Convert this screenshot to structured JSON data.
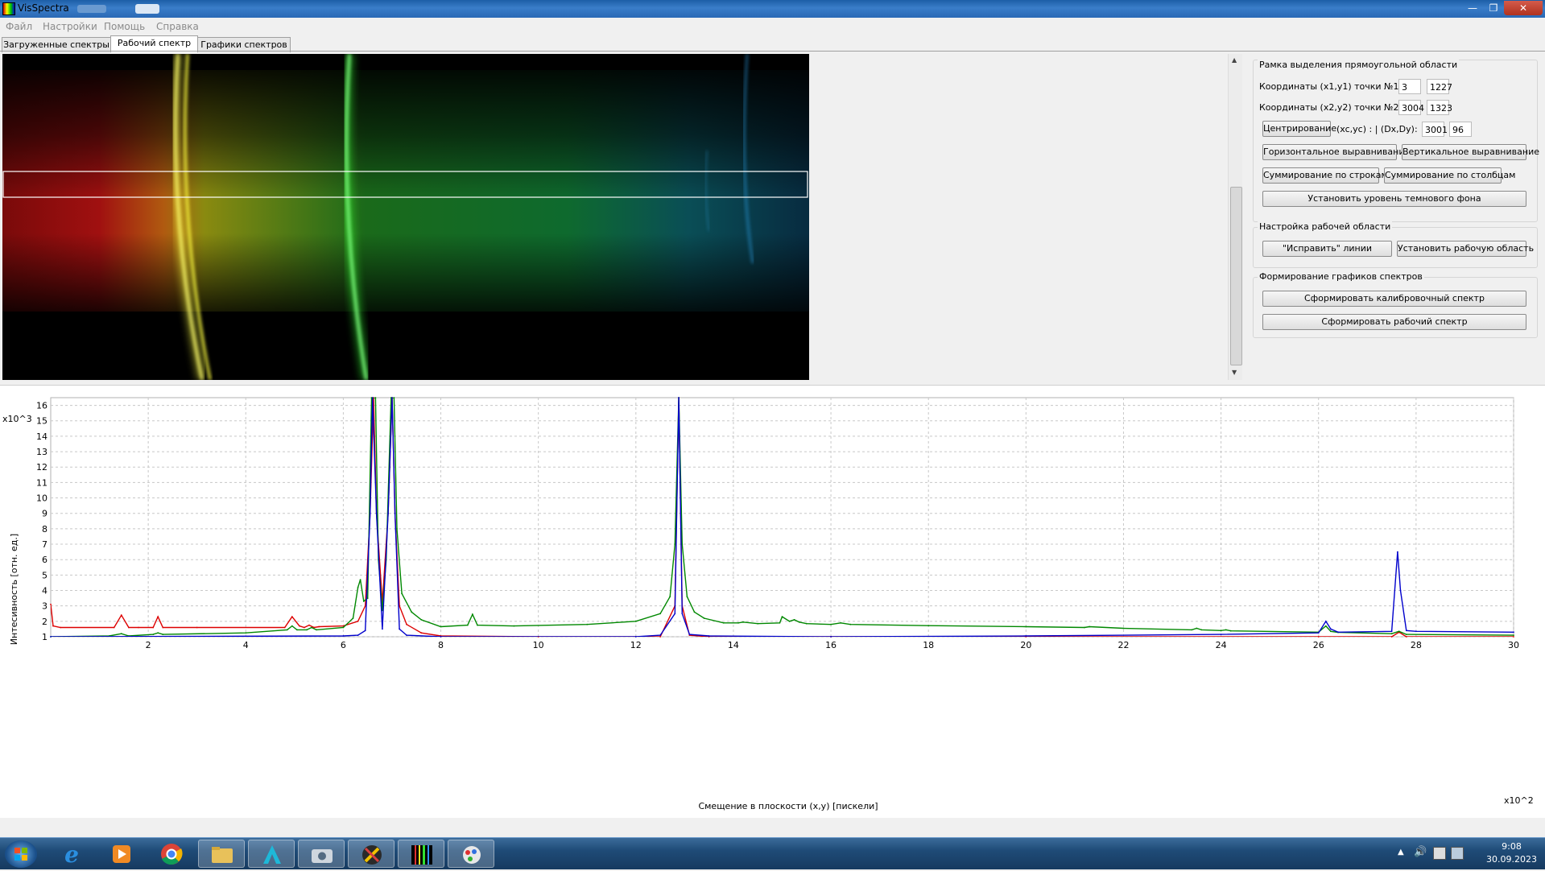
{
  "window": {
    "title": "VisSpectra"
  },
  "menu": [
    "Файл",
    "Настройки",
    "Помощь",
    "Справка"
  ],
  "tabs": [
    {
      "label": "Загруженные спектры",
      "active": false
    },
    {
      "label": "Рабочий спектр",
      "active": true
    },
    {
      "label": "Графики спектров",
      "active": false
    }
  ],
  "panel": {
    "group1": {
      "title": "Рамка выделения прямоугольной области",
      "p1_label": "Координаты (x1,y1) точки №1 :",
      "p1_x": "3",
      "p1_y": "1227",
      "p2_label": "Координаты (x2,y2) точки №2 :",
      "p2_x": "3004",
      "p2_y": "1323",
      "center_button": "Центрирование",
      "center_label": "(xc,yc) :   |  (Dx,Dy):",
      "dx": "3001",
      "dy": "96",
      "h_align": "Горизонтальное выравнивание",
      "v_align": "Вертикальное выравнивание",
      "sum_rows": "Суммирование  по  строкам",
      "sum_cols": "Суммирование по столбцам",
      "dark_level": "Установить уровень темнового фона"
    },
    "group2": {
      "title": "Настройка рабочей области",
      "fix_lines": "\"Исправить\" линии",
      "set_area": "Установить рабочую область"
    },
    "group3": {
      "title": "Формирование графиков спектров",
      "calib": "Сформировать калибровочный спектр",
      "work": "Сформировать рабочий спектр"
    }
  },
  "chart_data": {
    "type": "line",
    "xlabel": "Смещение в плоскости (x,y) [пискели]",
    "ylabel": "Интесивность [отн. ед.]",
    "x_multiplier": "x10^2",
    "y_multiplier": "x10^3",
    "xlim": [
      0,
      30
    ],
    "ylim": [
      1,
      16.5
    ],
    "x_ticks": [
      2,
      4,
      6,
      8,
      10,
      12,
      14,
      16,
      18,
      20,
      22,
      24,
      26,
      28,
      30
    ],
    "y_ticks": [
      1,
      2,
      3,
      4,
      5,
      6,
      7,
      8,
      9,
      10,
      11,
      12,
      13,
      14,
      15,
      16
    ],
    "grid": true,
    "series": [
      {
        "color": "#dd0000",
        "x": [
          0,
          0.05,
          0.2,
          1.3,
          1.45,
          1.6,
          1.8,
          2.1,
          2.2,
          2.3,
          3,
          4.8,
          4.95,
          5.1,
          5.2,
          5.3,
          5.4,
          5.5,
          6.0,
          6.3,
          6.45,
          6.55,
          6.62,
          6.68,
          6.8,
          6.92,
          7.0,
          7.06,
          7.15,
          7.3,
          7.6,
          8,
          10,
          12.5,
          12.8,
          12.88,
          12.95,
          13.1,
          13.5,
          16,
          20,
          26,
          27.5,
          27.65,
          27.8,
          30
        ],
        "y": [
          3.1,
          1.7,
          1.6,
          1.6,
          2.4,
          1.6,
          1.6,
          1.6,
          2.3,
          1.6,
          1.6,
          1.6,
          2.3,
          1.7,
          1.6,
          1.75,
          1.6,
          1.65,
          1.7,
          2.0,
          3.0,
          9.0,
          16.5,
          9.0,
          3.2,
          9.0,
          16.5,
          9.0,
          3.0,
          1.8,
          1.25,
          1.05,
          1.0,
          1.0,
          3.0,
          16.5,
          3.0,
          1.1,
          1.0,
          1.0,
          1.0,
          1.0,
          1.0,
          1.3,
          1.0,
          1.0
        ]
      },
      {
        "color": "#008800",
        "x": [
          0,
          1.2,
          1.45,
          1.6,
          2.1,
          2.2,
          2.3,
          4.0,
          4.85,
          4.95,
          5.05,
          5.25,
          5.35,
          5.45,
          6.0,
          6.2,
          6.3,
          6.35,
          6.42,
          6.5,
          6.58,
          6.66,
          6.72,
          6.8,
          6.88,
          6.98,
          7.04,
          7.1,
          7.2,
          7.4,
          7.6,
          8.0,
          8.55,
          8.65,
          8.75,
          9.5,
          11.0,
          12.0,
          12.5,
          12.7,
          12.8,
          12.88,
          12.95,
          13.05,
          13.2,
          13.4,
          13.8,
          14.1,
          14.2,
          14.5,
          14.95,
          15.0,
          15.15,
          15.25,
          15.35,
          15.5,
          16.0,
          16.2,
          16.4,
          18.0,
          20.0,
          21.2,
          21.3,
          22.0,
          23.4,
          23.5,
          23.6,
          24.0,
          24.1,
          24.2,
          26.0,
          26.15,
          26.25,
          26.4,
          27.5,
          27.65,
          27.8,
          30.0
        ],
        "y": [
          1.0,
          1.05,
          1.2,
          1.05,
          1.15,
          1.25,
          1.15,
          1.25,
          1.45,
          1.7,
          1.45,
          1.45,
          1.6,
          1.45,
          1.6,
          2.2,
          4.2,
          4.7,
          3.3,
          3.5,
          16.5,
          16.5,
          6.0,
          2.7,
          6.0,
          16.5,
          16.5,
          8.0,
          3.8,
          2.6,
          2.1,
          1.65,
          1.75,
          2.45,
          1.75,
          1.7,
          1.8,
          2.0,
          2.5,
          3.6,
          7.0,
          16.5,
          7.0,
          3.6,
          2.6,
          2.2,
          1.9,
          1.9,
          1.95,
          1.85,
          1.9,
          2.3,
          2.0,
          2.1,
          1.95,
          1.85,
          1.8,
          1.9,
          1.8,
          1.72,
          1.65,
          1.6,
          1.65,
          1.55,
          1.45,
          1.55,
          1.45,
          1.4,
          1.45,
          1.38,
          1.3,
          1.7,
          1.35,
          1.28,
          1.2,
          1.35,
          1.15,
          1.1
        ]
      },
      {
        "color": "#0000cc",
        "x": [
          0,
          6.0,
          6.3,
          6.45,
          6.55,
          6.6,
          6.68,
          6.8,
          6.92,
          7.0,
          7.06,
          7.15,
          7.3,
          8.0,
          12.0,
          12.5,
          12.8,
          12.88,
          12.95,
          13.1,
          13.5,
          16.0,
          20.0,
          24.0,
          26.0,
          26.15,
          26.25,
          26.4,
          27.5,
          27.62,
          27.68,
          27.8,
          28.0,
          30.0
        ],
        "y": [
          1.0,
          1.05,
          1.1,
          1.4,
          9.0,
          16.5,
          9.0,
          1.5,
          9.0,
          16.5,
          9.0,
          1.5,
          1.1,
          1.0,
          1.0,
          1.1,
          2.5,
          16.5,
          2.5,
          1.15,
          1.05,
          1.0,
          1.05,
          1.15,
          1.25,
          2.0,
          1.5,
          1.3,
          1.35,
          6.5,
          4.0,
          1.4,
          1.35,
          1.3
        ]
      }
    ]
  },
  "taskbar": {
    "items": [
      "start-button",
      "ie-icon",
      "media-player-icon",
      "chrome-icon",
      "explorer-icon",
      "autodesk-icon",
      "camera-icon",
      "tool-icon",
      "visspectra-icon",
      "paint-icon"
    ],
    "time": "9:08",
    "date": "30.09.2023"
  }
}
